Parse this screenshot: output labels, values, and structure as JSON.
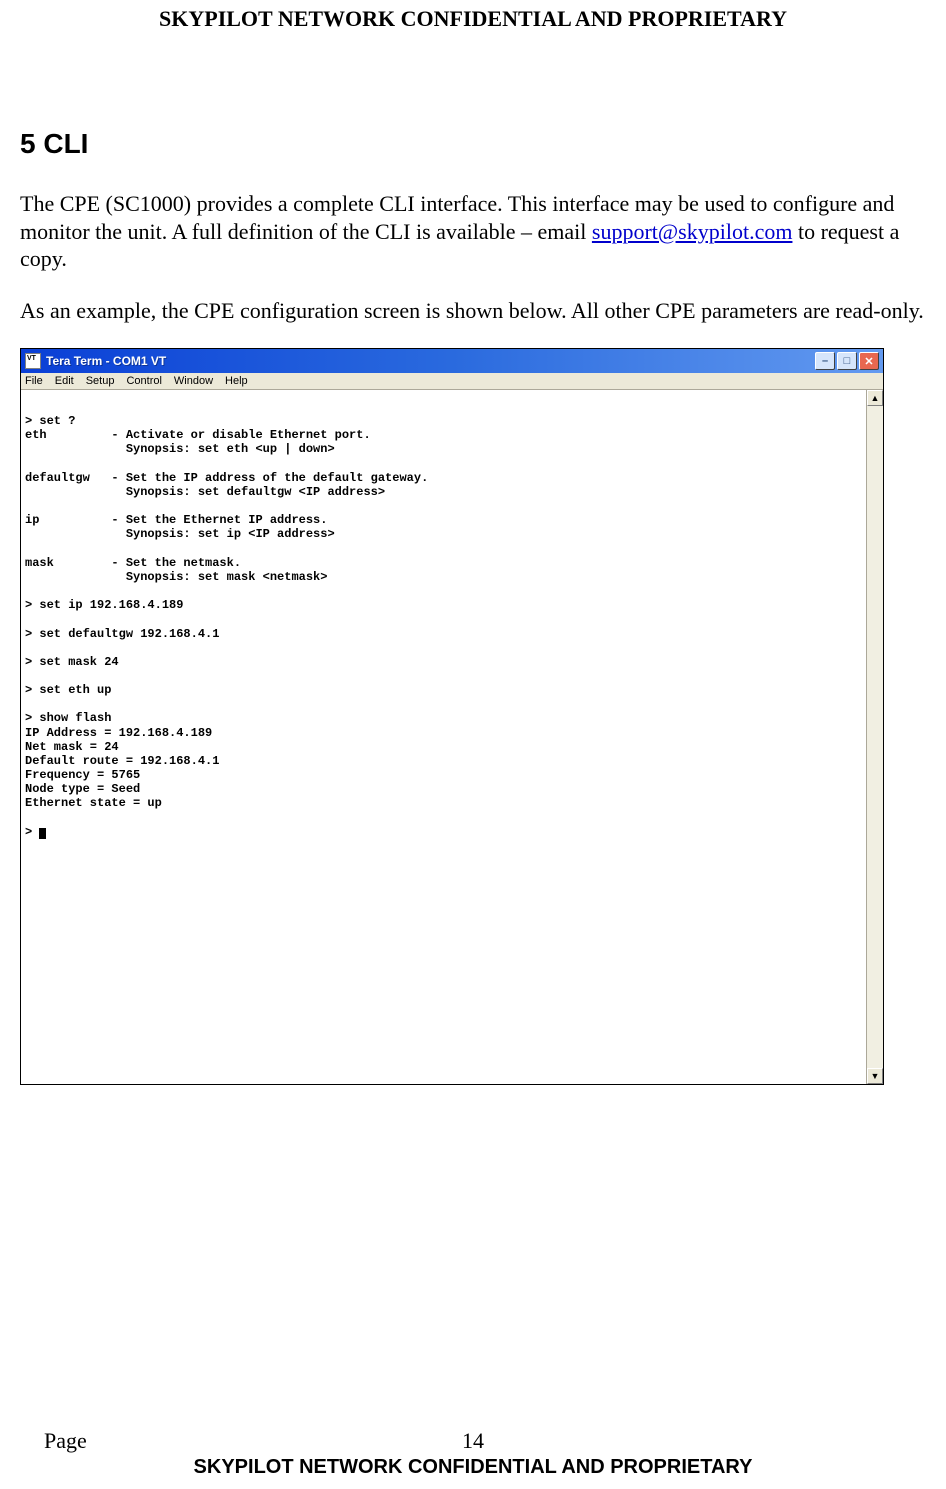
{
  "header": {
    "confidential": "SKYPILOT NETWORK CONFIDENTIAL AND PROPRIETARY"
  },
  "section": {
    "number_and_title": "5   CLI"
  },
  "paragraphs": {
    "p1_a": "The CPE (SC1000) provides a complete CLI interface. This interface may be used to configure and monitor the unit. A full definition of the CLI is available – email ",
    "p1_link": "support@skypilot.com",
    "p1_b": " to request a copy.",
    "p2": "As an example, the CPE configuration screen is shown below. All other CPE parameters are read-only."
  },
  "teraterm": {
    "title": "Tera Term - COM1 VT",
    "menu": {
      "file": "File",
      "edit": "Edit",
      "setup": "Setup",
      "control": "Control",
      "window": "Window",
      "help": "Help"
    },
    "terminal_text": "\n> set ?\neth         - Activate or disable Ethernet port.\n              Synopsis: set eth <up | down>\n\ndefaultgw   - Set the IP address of the default gateway.\n              Synopsis: set defaultgw <IP address>\n\nip          - Set the Ethernet IP address.\n              Synopsis: set ip <IP address>\n\nmask        - Set the netmask.\n              Synopsis: set mask <netmask>\n\n> set ip 192.168.4.189\n\n> set defaultgw 192.168.4.1\n\n> set mask 24\n\n> set eth up\n\n> show flash\nIP Address = 192.168.4.189\nNet mask = 24\nDefault route = 192.168.4.1\nFrequency = 5765\nNode type = Seed\nEthernet state = up\n\n> "
  },
  "footer": {
    "page_label": "Page",
    "page_number": "14",
    "confidential": "SKYPILOT NETWORK CONFIDENTIAL AND PROPRIETARY"
  },
  "icons": {
    "minimize": "–",
    "maximize": "□",
    "close": "✕",
    "scroll_up": "▲",
    "scroll_down": "▼"
  }
}
